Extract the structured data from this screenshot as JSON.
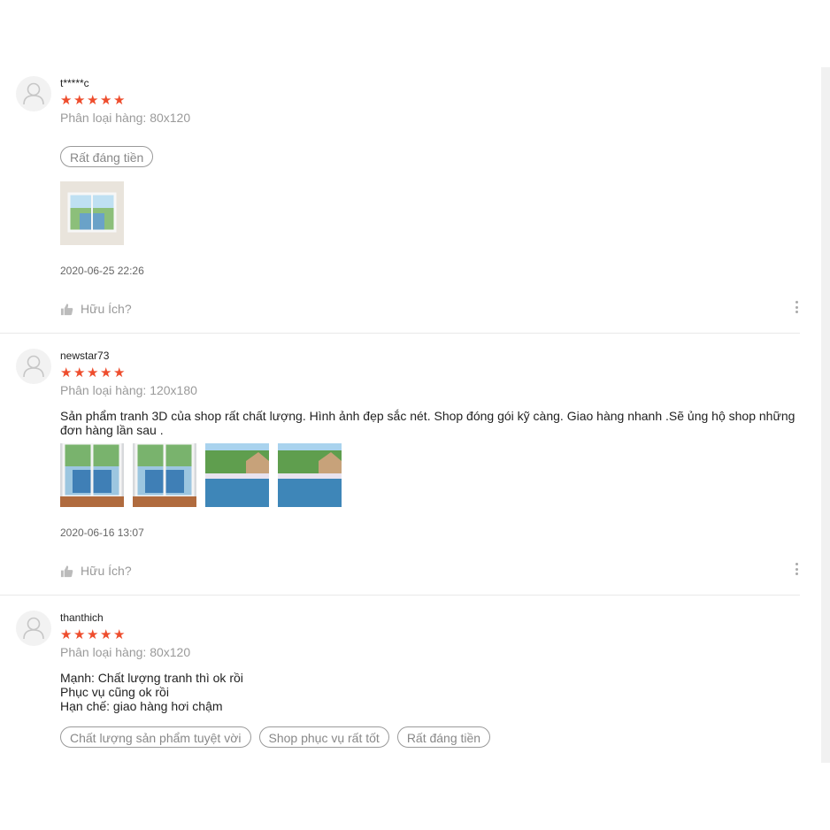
{
  "reviews": [
    {
      "username": "t*****c",
      "rating": 5,
      "variation": "Phân loại hàng: 80x120",
      "tags": [
        "Rất đáng tiền"
      ],
      "date": "2020-06-25 22:26",
      "helpful_label": "Hữu Ích?"
    },
    {
      "username": "newstar73",
      "rating": 5,
      "variation": "Phân loại hàng: 120x180",
      "text": "Sản phẩm tranh 3D của shop rất chất lượng. Hình ảnh đẹp sắc nét. Shop đóng gói kỹ càng. Giao hàng nhanh .Sẽ ủng hộ shop những đơn hàng lần sau .",
      "date": "2020-06-16 13:07",
      "helpful_label": "Hữu Ích?"
    },
    {
      "username": "thanthich",
      "rating": 5,
      "variation": "Phân loại hàng: 80x120",
      "text_lines": [
        "Mạnh: Chất lượng tranh thì ok rồi",
        "Phục vụ cũng ok rồi",
        "Hạn chế: giao hàng hơi chậm"
      ],
      "tags": [
        "Chất lượng sản phẩm tuyệt vời",
        "Shop phục vụ rất tốt",
        "Rất đáng tiền"
      ]
    }
  ],
  "star_glyph": "★",
  "colors": {
    "star": "#ee4d2d",
    "muted": "#9a9a9a"
  },
  "icons": {
    "avatar": "user-placeholder-icon",
    "thumb": "thumbs-up-icon",
    "more": "kebab-menu-icon"
  }
}
